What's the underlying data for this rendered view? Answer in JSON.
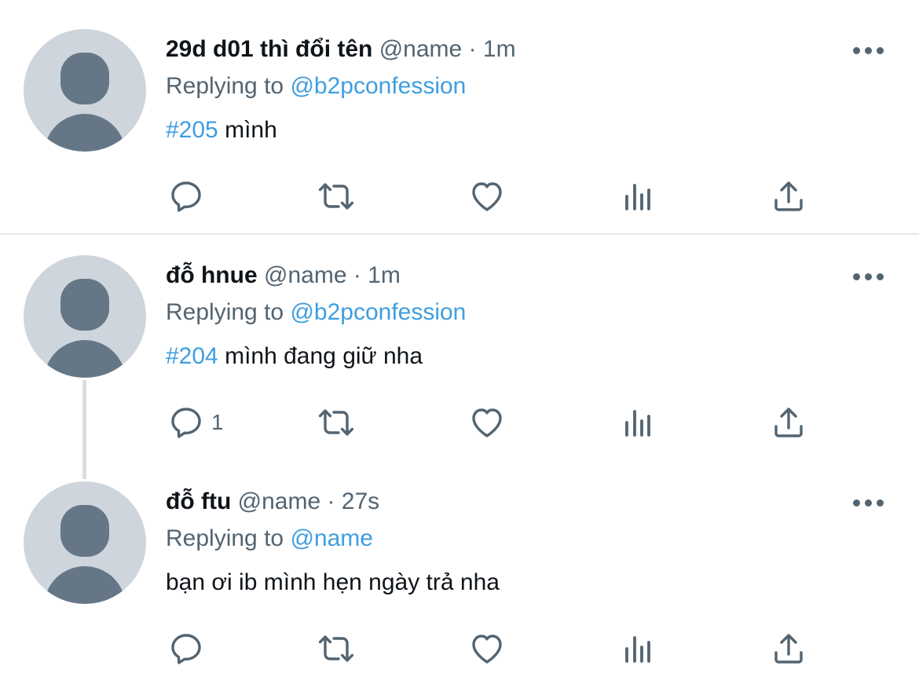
{
  "tweets": [
    {
      "name": "29d d01 thì đổi tên",
      "handle": "@name",
      "time": "· 1m",
      "replying_label": "Replying to",
      "replying_to": "@b2pconfession",
      "hashtag": "#205",
      "text": " mình",
      "reply_count": ""
    },
    {
      "name": "đỗ hnue",
      "handle": "@name",
      "time": "· 1m",
      "replying_label": "Replying to",
      "replying_to": "@b2pconfession",
      "hashtag": "#204",
      "text": " mình đang giữ nha",
      "reply_count": "1"
    },
    {
      "name": "đỗ ftu",
      "handle": "@name",
      "time": "· 27s",
      "replying_label": "Replying to",
      "replying_to": "@name",
      "hashtag": "",
      "text": "bạn ơi ib mình hẹn ngày trả nha",
      "reply_count": ""
    }
  ],
  "icons": {
    "reply": "reply-icon",
    "retweet": "retweet-icon",
    "like": "heart-icon",
    "views": "analytics-icon",
    "share": "share-icon",
    "more": "more-icon"
  },
  "colors": {
    "link": "#3f9ee0",
    "muted": "#536471",
    "avatar_bg": "#ced5dc",
    "avatar_fg": "#657786"
  }
}
